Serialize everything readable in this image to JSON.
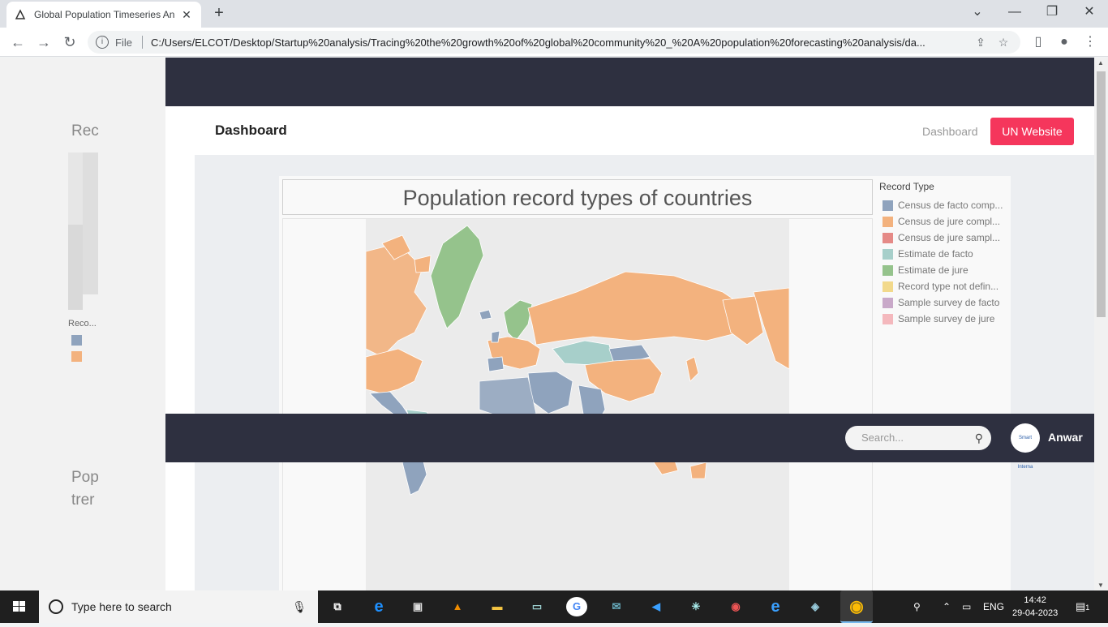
{
  "browser": {
    "tab_title": "Global Population Timeseries An",
    "file_label": "File",
    "url": "C:/Users/ELCOT/Desktop/Startup%20analysis/Tracing%20the%20growth%20of%20global%20community%20_%20A%20population%20forecasting%20analysis/da..."
  },
  "left_pane": {
    "heading_partial": "Rec",
    "legend_partial": "Reco...",
    "text_partial_1": "Pop",
    "text_partial_2": "trer"
  },
  "header": {
    "title": "Dashboard",
    "nav_link": "Dashboard",
    "un_button": "UN Website"
  },
  "viz": {
    "title": "Population record types of countries",
    "legend_title": "Record Type",
    "legend": [
      {
        "label": "Census de facto comp...",
        "color": "#8fa3bd"
      },
      {
        "label": "Census de jure compl...",
        "color": "#f3b27e"
      },
      {
        "label": "Census de jure sampl...",
        "color": "#e58a87"
      },
      {
        "label": "Estimate de facto",
        "color": "#a7cfca"
      },
      {
        "label": "Estimate de jure",
        "color": "#95c38c"
      },
      {
        "label": "Record type not defin...",
        "color": "#f2d98b"
      },
      {
        "label": "Sample survey de facto",
        "color": "#c9a9c9"
      },
      {
        "label": "Sample survey de jure",
        "color": "#f4b8bd"
      }
    ]
  },
  "footer_bar": {
    "search_placeholder": "Search...",
    "avatar_text": "Smart Interna",
    "user_name": "Anwar"
  },
  "taskbar": {
    "search_text": "Type here to search",
    "language": "ENG",
    "time": "14:42",
    "date": "29-04-2023",
    "notification_count": "1"
  }
}
